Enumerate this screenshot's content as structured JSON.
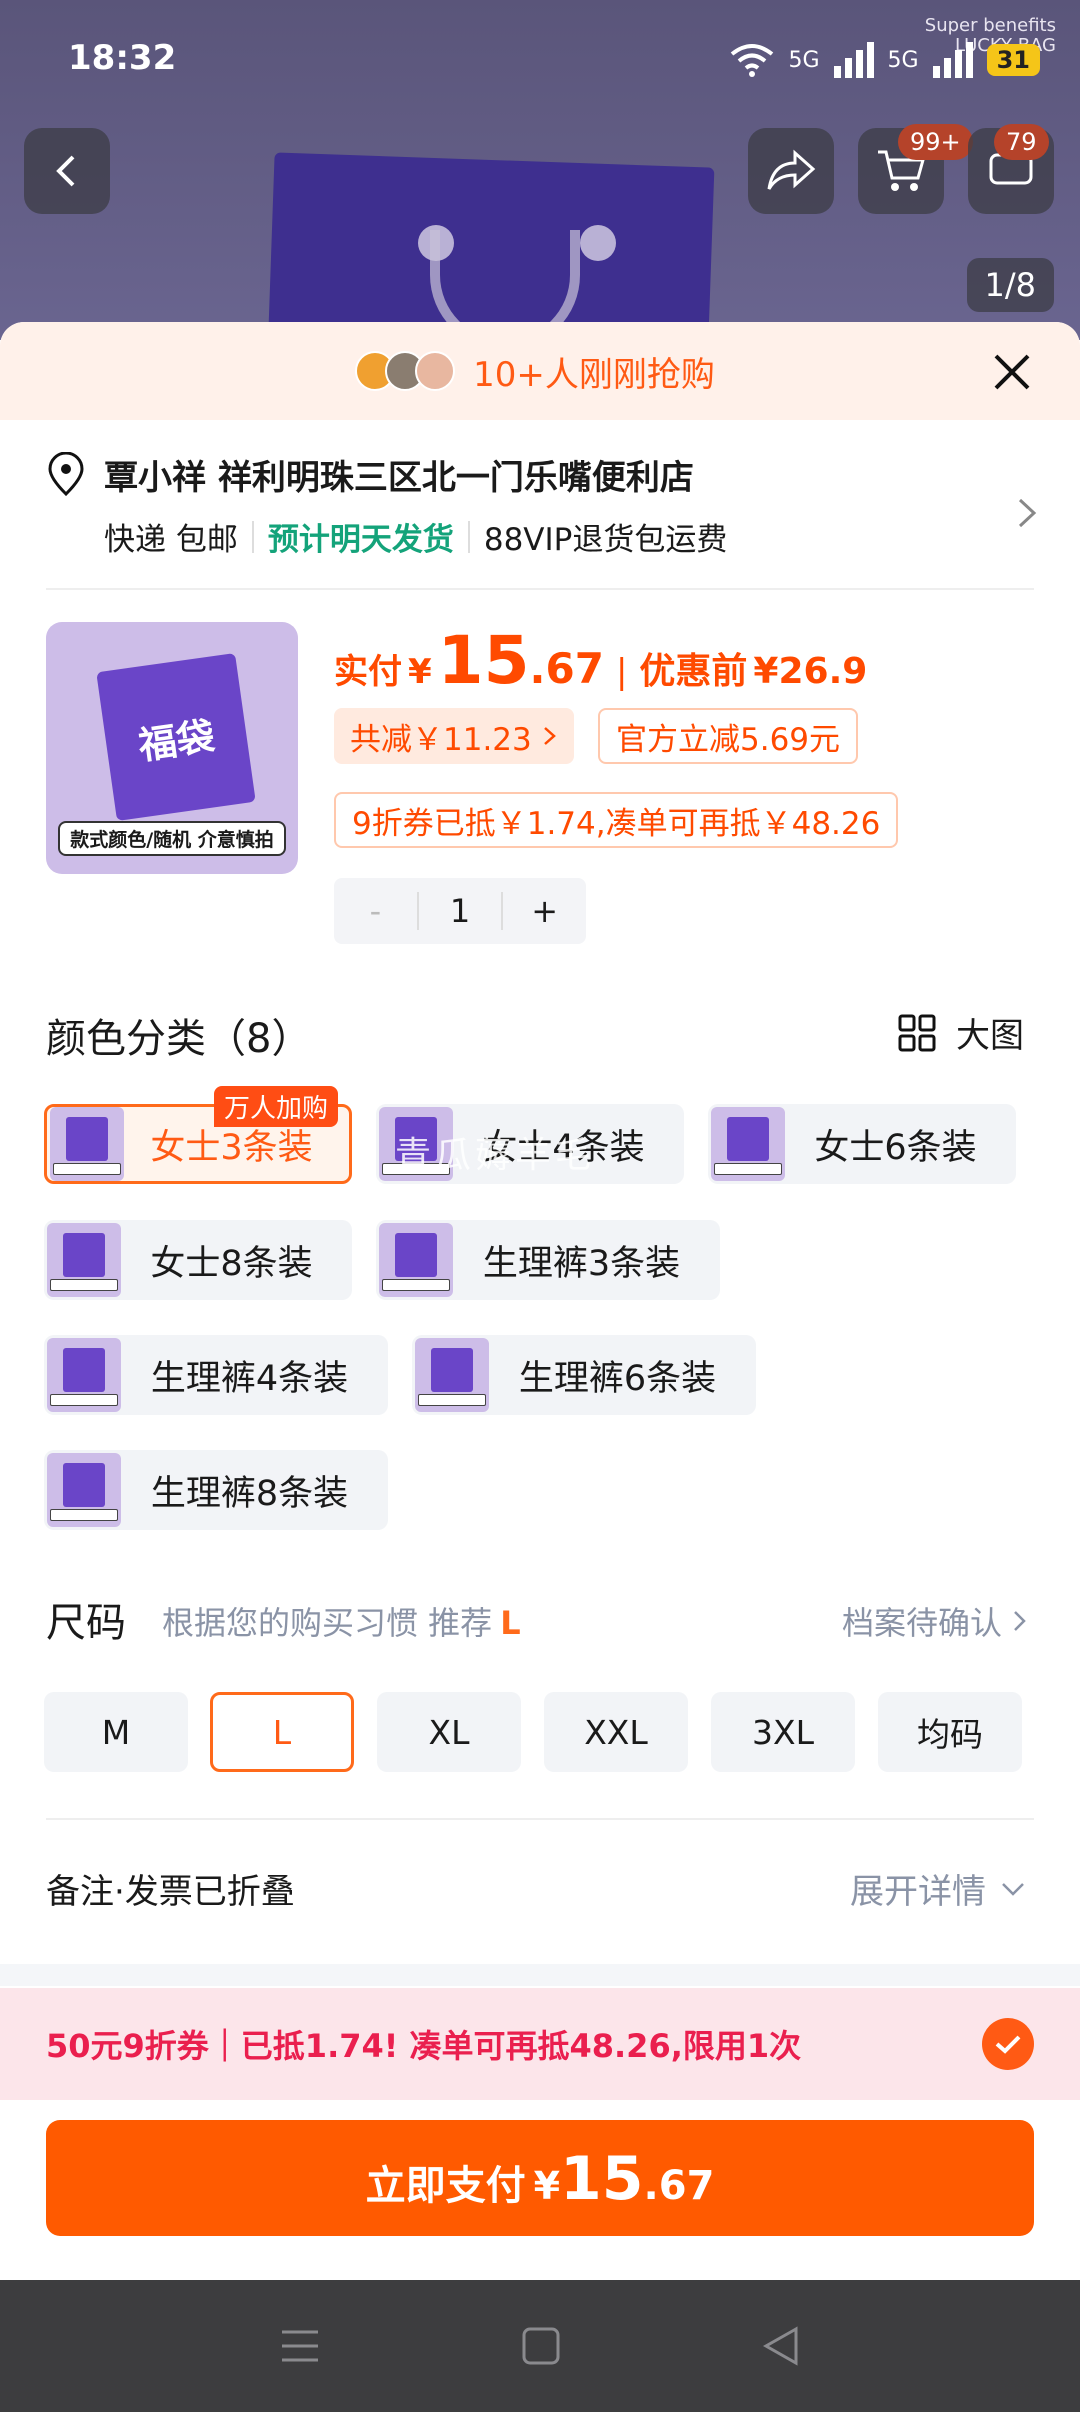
{
  "status": {
    "time": "18:32",
    "net1": "5G",
    "net2": "5G",
    "battery": "31",
    "brand_line1": "Super benefits",
    "brand_line2": "LUCKY BAG"
  },
  "nav": {
    "cart_badge": "99+",
    "msg_badge": "79",
    "page_indicator": "1/8"
  },
  "banner": {
    "text": "10+人刚刚抢购"
  },
  "address": {
    "name": "覃小祥 祥利明珠三区北一门乐嘴便利店",
    "shipping": "快递 包邮",
    "delivery": "预计明天发货",
    "returns": "88VIP退货包运费"
  },
  "product": {
    "thumb_text": "福袋",
    "thumb_caption": "款式颜色/随机  介意慎拍",
    "pay_label": "实付",
    "currency": "¥",
    "price_int": "15",
    "price_dec": ".67",
    "before_label": "优惠前",
    "before_price": "¥26.9",
    "total_off": "共减￥11.23",
    "official_off": "官方立减5.69元",
    "coupon_info": "9折券已抵￥1.74,凑单可再抵￥48.26",
    "qty": "1",
    "minus": "-",
    "plus": "+"
  },
  "color": {
    "title": "颜色分类（8）",
    "big_view": "大图",
    "hot_tag": "万人加购",
    "watermark": "青瓜薅羊毛",
    "options": [
      "女士3条装",
      "女士4条装",
      "女士6条装",
      "女士8条装",
      "生理裤3条装",
      "生理裤4条装",
      "生理裤6条装",
      "生理裤8条装"
    ],
    "selected_index": 0
  },
  "size": {
    "title": "尺码",
    "hint": "根据您的购买习惯 推荐",
    "hint_value": "L",
    "profile": "档案待确认",
    "options": [
      "M",
      "L",
      "XL",
      "XXL",
      "3XL",
      "均码"
    ],
    "selected_index": 1
  },
  "note": {
    "label": "备注·发票已折叠",
    "expand": "展开详情"
  },
  "coupon_bar": {
    "text": "50元9折券｜已抵1.74! 凑单可再抵48.26,限用1次"
  },
  "pay_button": {
    "label": "立即支付",
    "currency": "¥",
    "price_int": "15",
    "price_dec": ".67"
  },
  "colors": {
    "accent": "#ff5a00",
    "green": "#14a37a",
    "coupon_red": "#ea1f4e"
  }
}
